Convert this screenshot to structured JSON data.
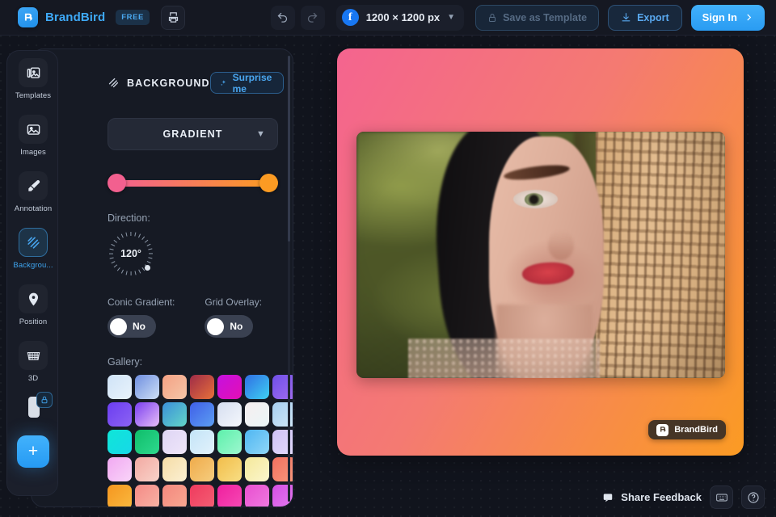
{
  "app": {
    "brand_name": "BrandBird",
    "plan_badge": "FREE",
    "logo_icon": "brandbird-logo-icon",
    "print_icon": "printer-icon"
  },
  "topbar": {
    "undo_icon": "undo-arrow-icon",
    "redo_icon": "redo-arrow-icon",
    "size_platform_icon": "facebook-icon",
    "size_label": "1200 × 1200 px",
    "size_chevron_icon": "chevron-down-icon",
    "save_template_label": "Save as Template",
    "save_template_icon": "lock-icon",
    "export_label": "Export",
    "export_icon": "download-icon",
    "signin_label": "Sign In",
    "signin_icon": "chevron-right-icon"
  },
  "rail": {
    "items": [
      {
        "label": "Templates",
        "icon": "templates-icon",
        "active": false
      },
      {
        "label": "Images",
        "icon": "image-icon",
        "active": false
      },
      {
        "label": "Annotation",
        "icon": "marker-pen-icon",
        "active": false
      },
      {
        "label": "Backgrou...",
        "icon": "background-hatch-icon",
        "active": true
      },
      {
        "label": "Position",
        "icon": "location-pin-icon",
        "active": false
      },
      {
        "label": "3D",
        "icon": "grid-3d-icon",
        "active": false
      }
    ],
    "locked_icon": "lock-icon",
    "add_label": "+",
    "add_icon": "plus-icon"
  },
  "panel": {
    "title": "BACKGROUND",
    "title_icon": "background-hatch-icon",
    "surprise_label": "Surprise me",
    "surprise_icon": "sparkles-icon",
    "type_select": {
      "value": "GRADIENT",
      "chevron_icon": "chevron-down-icon"
    },
    "gradient_stops": {
      "start_color": "#f2608f",
      "end_color": "#fb9b23"
    },
    "direction": {
      "label": "Direction:",
      "value": "120°"
    },
    "conic": {
      "label": "Conic Gradient:",
      "value": "No"
    },
    "grid_overlay": {
      "label": "Grid Overlay:",
      "value": "No"
    },
    "gallery": {
      "label": "Gallery:",
      "swatches": [
        "linear-gradient(135deg,#cfe3f7,#e9f3fb)",
        "linear-gradient(135deg,#6f8fe0,#cfe0f6)",
        "linear-gradient(135deg,#f5a184,#f3c6a8)",
        "linear-gradient(135deg,#9e2b48,#e8713a)",
        "linear-gradient(135deg,#c511e0,#e30fb4)",
        "linear-gradient(135deg,#2f6fe4,#3fd0f2)",
        "linear-gradient(135deg,#6f4fe6,#a36ef0)",
        "linear-gradient(135deg,#6b3df0,#8c63f3)",
        "linear-gradient(135deg,#7b3ff0,#e6bdf7)",
        "linear-gradient(135deg,#3b8fd9,#63d6c8)",
        "linear-gradient(135deg,#3f5fe8,#5c9ef2)",
        "linear-gradient(135deg,#d6def0,#f4f7fc)",
        "linear-gradient(135deg,#f6eef0,#eaf6f7)",
        "linear-gradient(135deg,#a7cef0,#d2e9f8)",
        "linear-gradient(135deg,#0fe6d8,#17d8e8)",
        "linear-gradient(135deg,#0fbd6a,#2ed98e)",
        "linear-gradient(135deg,#ded5f4,#efe6fa)",
        "linear-gradient(135deg,#c3e4f7,#e2f2fc)",
        "linear-gradient(135deg,#5df0ab,#9df7cf)",
        "linear-gradient(135deg,#4fb6f2,#8fd6f7)",
        "linear-gradient(135deg,#cfc1f7,#e4dcfb)",
        "linear-gradient(135deg,#f1a8f2,#f9d4f8)",
        "linear-gradient(135deg,#f3a9a2,#f8d3c9)",
        "linear-gradient(135deg,#f5dca6,#fbf0d3)",
        "linear-gradient(135deg,#efab4b,#f6cd7e)",
        "linear-gradient(135deg,#f2bd4a,#f8de84)",
        "linear-gradient(135deg,#f5e89a,#fbf6cd)",
        "linear-gradient(135deg,#f2705f,#f79a7e)",
        "linear-gradient(135deg,#f5961f,#f9b93f)",
        "linear-gradient(135deg,#f48b86,#f8b3a5)",
        "linear-gradient(135deg,#f4887e,#f7a892)",
        "linear-gradient(135deg,#ef3a5e,#f45f74)",
        "linear-gradient(135deg,#ef1f9e,#f64ab5)",
        "linear-gradient(135deg,#e84fd0,#f07ae0)",
        "linear-gradient(135deg,#d44fe4,#e47ef0)"
      ]
    }
  },
  "canvas": {
    "background_gradient": "linear-gradient(120deg,#f4648f 0%,#f47a72 45%,#fb9b23 100%)",
    "watermark_label": "BrandBird",
    "watermark_icon": "brandbird-logo-icon",
    "photo_alt": "portrait-photo"
  },
  "footer": {
    "feedback_label": "Share Feedback",
    "feedback_icon": "feedback-icon",
    "keyboard_icon": "keyboard-icon",
    "help_icon": "question-circle-icon"
  }
}
